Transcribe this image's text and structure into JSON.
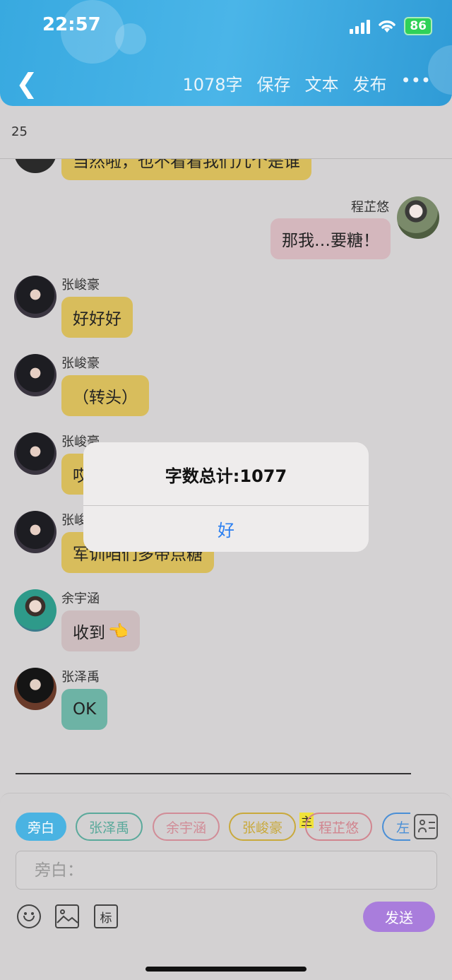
{
  "status": {
    "time": "22:57",
    "battery": "86"
  },
  "header": {
    "word_count": "1078字",
    "save": "保存",
    "text": "文本",
    "publish": "发布",
    "more": "•••"
  },
  "subbar": {
    "number": "25"
  },
  "messages": [
    {
      "side": "left",
      "name": "",
      "text": "当然啦，也不看看我们几个是谁",
      "color": "#d8bd5c"
    },
    {
      "side": "right",
      "name": "程芷悠",
      "text": "那我…要糖！",
      "color": "#d4b7bd"
    },
    {
      "side": "left",
      "name": "张峻豪",
      "text": "好好好",
      "color": "#d8bd5c"
    },
    {
      "side": "left",
      "name": "张峻豪",
      "text": "（转头）",
      "color": "#d8bd5c"
    },
    {
      "side": "left",
      "name": "张峻豪",
      "text": "哎",
      "color": "#d8bd5c"
    },
    {
      "side": "left",
      "name": "张峻",
      "text": "军训咱们多带点糖",
      "color": "#d8bd5c"
    },
    {
      "side": "left",
      "name": "余宇涵",
      "text": "收到",
      "emoji": "👈",
      "color": "#ccbcbe"
    },
    {
      "side": "left",
      "name": "张泽禹",
      "text": "OK",
      "color": "#6db3a5"
    }
  ],
  "dialog": {
    "title": "字数总计:1077",
    "ok": "好"
  },
  "roles": [
    {
      "label": "旁白",
      "border": "#4ab3e2",
      "fill": "#4ab3e2",
      "text": "#ffffff"
    },
    {
      "label": "张泽禹",
      "border": "#5aa99b",
      "fill": "",
      "text": "#5aa99b"
    },
    {
      "label": "余宇涵",
      "border": "#d18c97",
      "fill": "",
      "text": "#d18c97"
    },
    {
      "label": "张峻豪",
      "border": "#c9a93c",
      "fill": "",
      "text": "#c9a93c"
    },
    {
      "label": "程芷悠",
      "border": "#d1858f",
      "fill": "",
      "text": "#d1858f"
    },
    {
      "label": "左",
      "border": "#4a8fd6",
      "fill": "",
      "text": "#4a8fd6"
    }
  ],
  "main_badge": "主",
  "input": {
    "placeholder": "旁白："
  },
  "tools": {
    "label_tag": "标"
  },
  "send": "发送"
}
